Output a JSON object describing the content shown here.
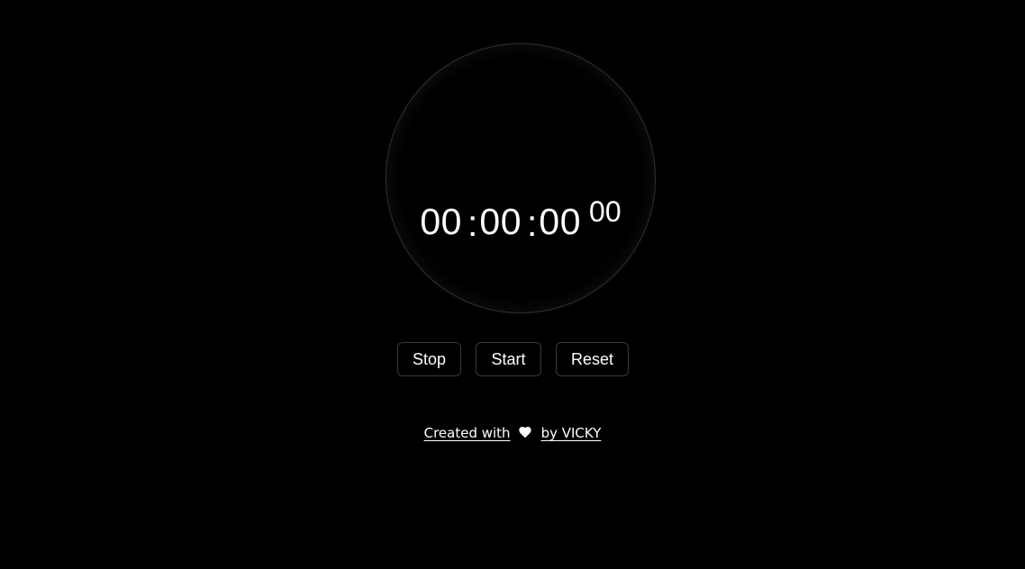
{
  "stopwatch": {
    "hours": "00",
    "minutes": "00",
    "seconds": "00",
    "milliseconds": "00",
    "separator": ":"
  },
  "controls": {
    "stop_label": "Stop",
    "start_label": "Start",
    "reset_label": "Reset"
  },
  "footer": {
    "prefix": "Created with",
    "icon": "heart-icon",
    "suffix": "by VICKY"
  },
  "colors": {
    "background": "#000000",
    "text": "#ffffff",
    "border": "#3a3a3a"
  }
}
